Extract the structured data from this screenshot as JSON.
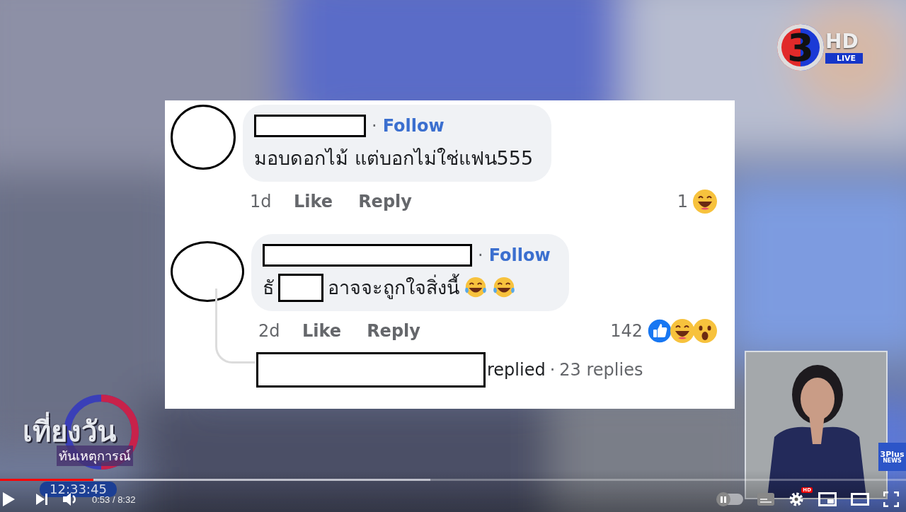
{
  "channel_logo": {
    "number": "3",
    "hd": "HD",
    "live": "LIVE"
  },
  "comments": [
    {
      "separator": "·",
      "follow": "Follow",
      "text_before": "มอบดอกไม้ แต่บอกไม่ใช่แฟน555",
      "redacted_word": false,
      "time": "1d",
      "like": "Like",
      "reply": "Reply",
      "reaction_count": "1",
      "reactions": [
        {
          "kind": "haha"
        }
      ]
    },
    {
      "separator": "·",
      "follow": "Follow",
      "text_before": "ธั",
      "redacted_word": true,
      "text_after": "อาจจะถูกใจสิ่งนี้",
      "emojis": [
        {
          "kind": "tears"
        },
        {
          "kind": "tears"
        }
      ],
      "time": "2d",
      "like": "Like",
      "reply": "Reply",
      "reaction_count": "142",
      "reactions": [
        {
          "kind": "like"
        },
        {
          "kind": "haha"
        },
        {
          "kind": "wow"
        }
      ],
      "replies": {
        "label": "replied",
        "separator": "·",
        "count": "23 replies"
      }
    }
  ],
  "program_logo": {
    "title": "เที่ยงวัน",
    "subtitle": "ทันเหตุการณ์"
  },
  "clock": "12:33:45",
  "news_badge": {
    "top": "3Plus",
    "bottom": "NEWS"
  },
  "player": {
    "level": 0.1035,
    "time": "0:53 / 8:32",
    "autoplay_on": false,
    "quality_badge": "HD"
  }
}
